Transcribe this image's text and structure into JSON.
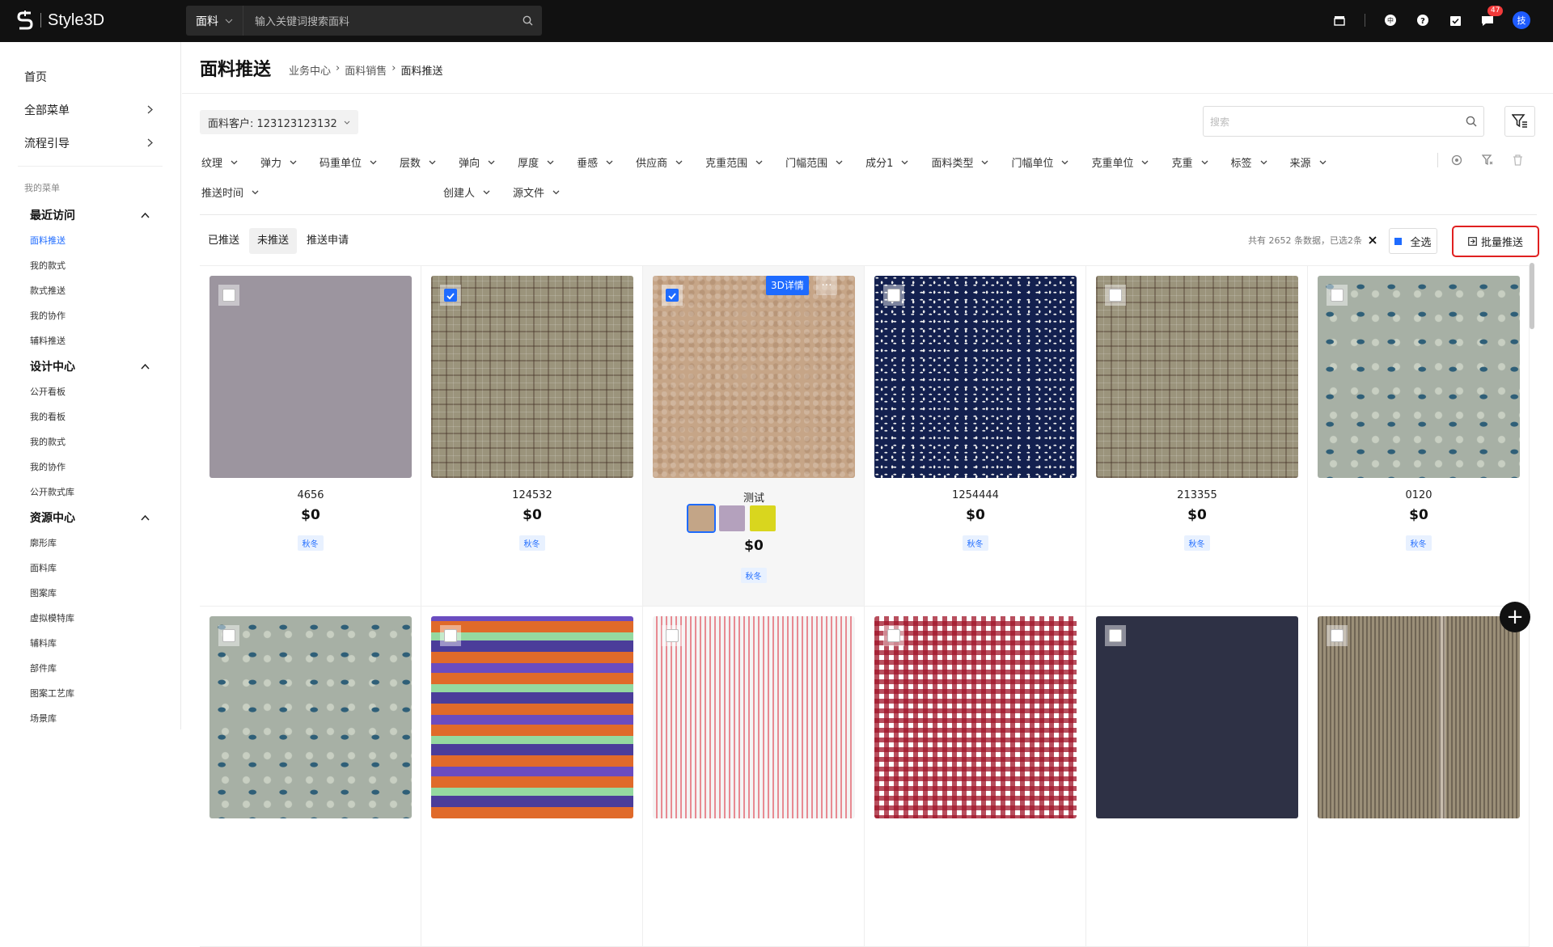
{
  "app": {
    "name": "Style3D"
  },
  "search": {
    "category": "面料",
    "placeholder": "输入关键词搜索面料"
  },
  "notifications": {
    "count": "47"
  },
  "user": {
    "avatar_text": "技"
  },
  "sidebar": {
    "top_items": [
      {
        "label": "首页"
      },
      {
        "label": "全部菜单"
      },
      {
        "label": "流程引导"
      }
    ],
    "my_menu_label": "我的菜单",
    "groups": [
      {
        "label": "最近访问",
        "items": [
          "面料推送",
          "我的款式",
          "款式推送",
          "我的协作",
          "辅料推送"
        ]
      },
      {
        "label": "设计中心",
        "items": [
          "公开看板",
          "我的看板",
          "我的款式",
          "我的协作",
          "公开款式库"
        ]
      },
      {
        "label": "资源中心",
        "items": [
          "廓形库",
          "面料库",
          "图案库",
          "虚拟模特库",
          "辅料库",
          "部件库",
          "图案工艺库",
          "场景库"
        ]
      }
    ]
  },
  "page": {
    "title": "面料推送",
    "breadcrumb": [
      "业务中心",
      "面料销售",
      "面料推送"
    ],
    "customer_select": "面料客户: 123123123132",
    "search_placeholder": "搜索"
  },
  "filters": [
    "纹理",
    "弹力",
    "码重单位",
    "层数",
    "弹向",
    "厚度",
    "垂感",
    "供应商",
    "克重范围",
    "门幅范围",
    "成分1",
    "面料类型",
    "门幅单位",
    "克重单位",
    "克重",
    "标签",
    "来源",
    "推送时间",
    "创建人",
    "源文件"
  ],
  "tabs": [
    {
      "label": "已推送",
      "active": false
    },
    {
      "label": "未推送",
      "active": true
    },
    {
      "label": "推送申请",
      "active": false
    }
  ],
  "stats": {
    "text": "共有 2652 条数据，已选2条"
  },
  "actions": {
    "select_all": "全选",
    "batch_push": "批量推送"
  },
  "cards": [
    {
      "name": "4656",
      "price": "$0",
      "tag": "秋冬",
      "pattern": "p-grey",
      "checked": false
    },
    {
      "name": "124532",
      "price": "$0",
      "tag": "秋冬",
      "pattern": "p-plaid",
      "checked": true
    },
    {
      "name": "测试",
      "price": "$0",
      "tag": "秋冬",
      "pattern": "p-sherpa",
      "checked": true,
      "detail_label": "3D详情",
      "swatches": [
        "#c3a587",
        "#b4a1bd",
        "#d9d61e"
      ]
    },
    {
      "name": "1254444",
      "price": "$0",
      "tag": "秋冬",
      "pattern": "p-navy",
      "checked": false
    },
    {
      "name": "213355",
      "price": "$0",
      "tag": "秋冬",
      "pattern": "p-plaid",
      "checked": false
    },
    {
      "name": "0120",
      "price": "$0",
      "tag": "秋冬",
      "pattern": "p-floral",
      "checked": false
    },
    {
      "pattern": "p-floral",
      "checked": false
    },
    {
      "pattern": "p-stripe",
      "checked": false
    },
    {
      "pattern": "p-pin",
      "checked": false
    },
    {
      "pattern": "p-ging",
      "checked": false
    },
    {
      "pattern": "p-dark",
      "checked": false
    },
    {
      "pattern": "p-tweed",
      "checked": false
    }
  ],
  "colors": {
    "accent": "#1e6bff",
    "highlight": "#e02020",
    "topbar": "#111111"
  }
}
